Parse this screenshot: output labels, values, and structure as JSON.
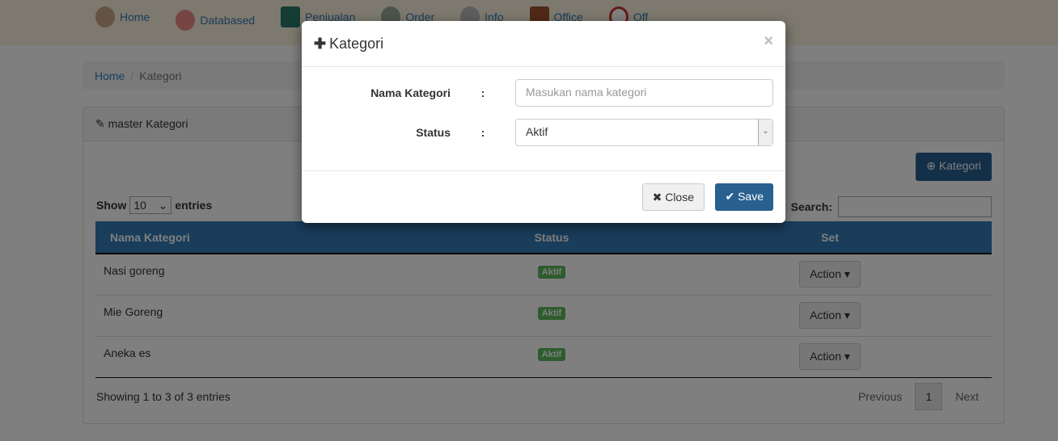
{
  "nav": {
    "items": [
      {
        "label": "Home",
        "icon": "chef-icon"
      },
      {
        "label": "Databased",
        "icon": "plate-icon"
      },
      {
        "label": "Penjualan",
        "icon": "cash-register-icon"
      },
      {
        "label": "Order",
        "icon": "order-icon"
      },
      {
        "label": "Info",
        "icon": "coffee-icon"
      },
      {
        "label": "Office",
        "icon": "briefcase-icon"
      },
      {
        "label": "Off",
        "icon": "power-icon"
      }
    ]
  },
  "breadcrumb": {
    "home": "Home",
    "current": "Kategori"
  },
  "panel": {
    "title": "master Kategori",
    "add_button": "Kategori"
  },
  "table_controls": {
    "show": "Show",
    "page_size": "10",
    "entries": "entries",
    "search_label": "Search:"
  },
  "table": {
    "headers": [
      "Nama Kategori",
      "Status",
      "Set"
    ],
    "rows": [
      {
        "name": "Nasi goreng",
        "status": "Aktif",
        "action": "Action"
      },
      {
        "name": "Mie Goreng",
        "status": "Aktif",
        "action": "Action"
      },
      {
        "name": "Aneka es",
        "status": "Aktif",
        "action": "Action"
      }
    ]
  },
  "footer": {
    "info": "Showing 1 to 3 of 3 entries",
    "previous": "Previous",
    "page": "1",
    "next": "Next"
  },
  "modal": {
    "title": "Kategori",
    "close_x": "×",
    "name_label": "Nama Kategori",
    "colon": ":",
    "name_placeholder": "Masukan nama kategori",
    "status_label": "Status",
    "status_value": "Aktif",
    "close_button": "Close",
    "save_button": "Save"
  },
  "colors": {
    "primary": "#337ab7",
    "success": "#5cb85c"
  }
}
